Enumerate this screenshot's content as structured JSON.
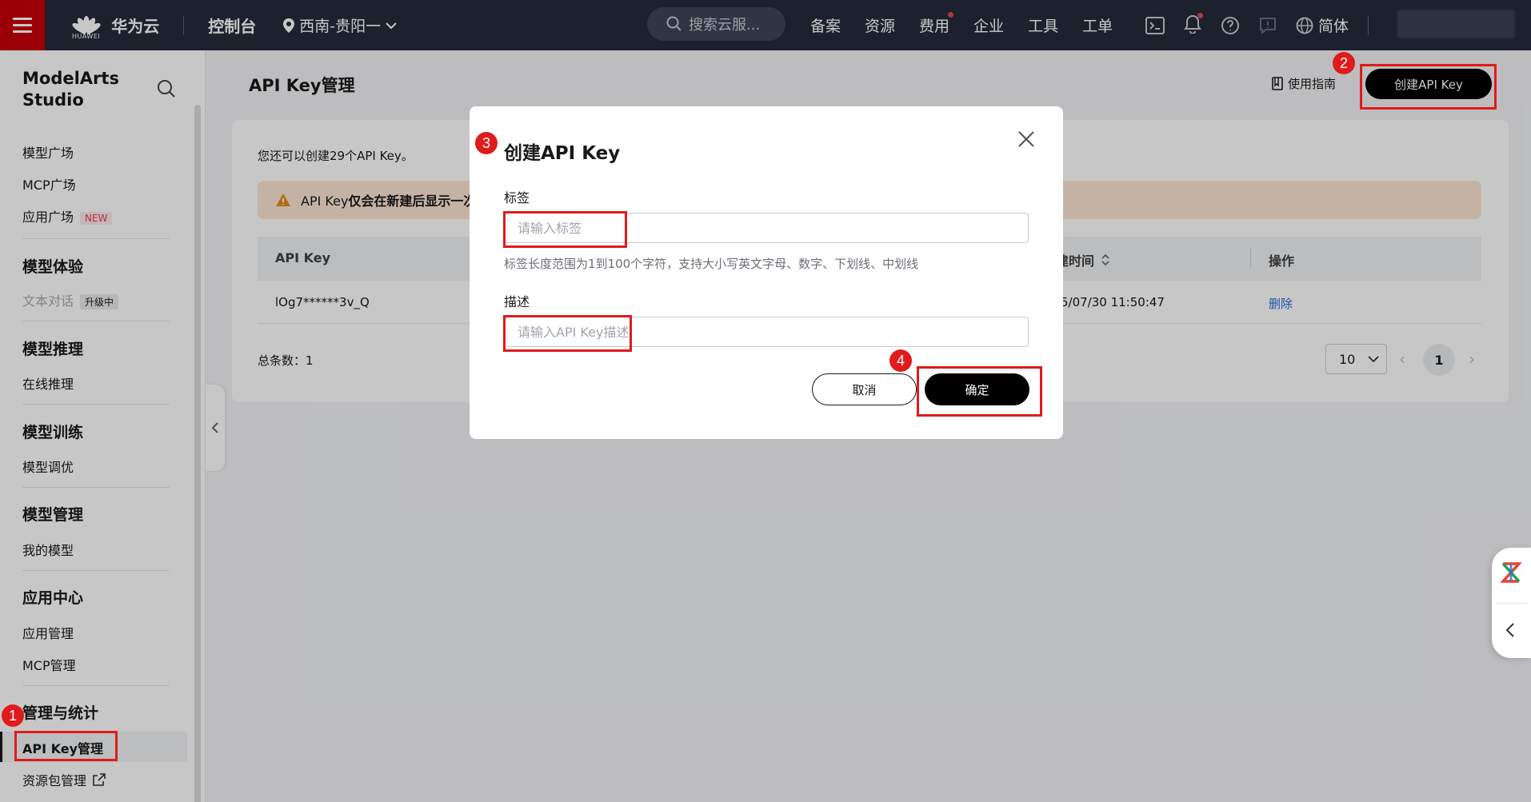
{
  "topbar": {
    "brand_sub": "HUAWEI",
    "brand": "华为云",
    "console": "控制台",
    "region": "西南-贵阳一",
    "search_placeholder": "搜索云服...",
    "nav": [
      "备案",
      "资源",
      "费用",
      "企业",
      "工具",
      "工单"
    ],
    "lang": "简体"
  },
  "sidebar": {
    "title": "ModelArts Studio",
    "items_top": [
      "模型广场",
      "MCP广场",
      "应用广场"
    ],
    "new_badge": "NEW",
    "groups": {
      "experience": "模型体验",
      "text_chat": "文本对话",
      "upgrading": "升级中",
      "inference": "模型推理",
      "online_inference": "在线推理",
      "training": "模型训练",
      "finetune": "模型调优",
      "management": "模型管理",
      "my_models": "我的模型",
      "app_center": "应用中心",
      "app_manage": "应用管理",
      "mcp_manage": "MCP管理",
      "stats": "管理与统计",
      "apikey": "API Key管理",
      "package": "资源包管理"
    }
  },
  "main": {
    "title": "API Key管理",
    "guide": "使用指南",
    "create_button": "创建API Key",
    "remain": "您还可以创建29个API Key。",
    "warn_prefix": "API Key",
    "warn_bold": "仅会在新建后显示一次",
    "table": {
      "col_key": "API Key",
      "col_time": "建时间",
      "col_action": "操作",
      "row_key": "lOg7******3v_Q",
      "row_time": "5/07/30 11:50:47",
      "row_action": "删除"
    },
    "total": "总条数：1",
    "page_size": "10",
    "current_page": "1"
  },
  "dialog": {
    "title": "创建API Key",
    "label_tag": "标签",
    "tag_placeholder": "请输入标签",
    "tag_hint": "标签长度范围为1到100个字符，支持大小写英文字母、数字、下划线、中划线",
    "label_desc": "描述",
    "desc_placeholder": "请输入API Key描述",
    "cancel": "取消",
    "ok": "确定"
  },
  "annotations": [
    "1",
    "2",
    "3",
    "4"
  ]
}
